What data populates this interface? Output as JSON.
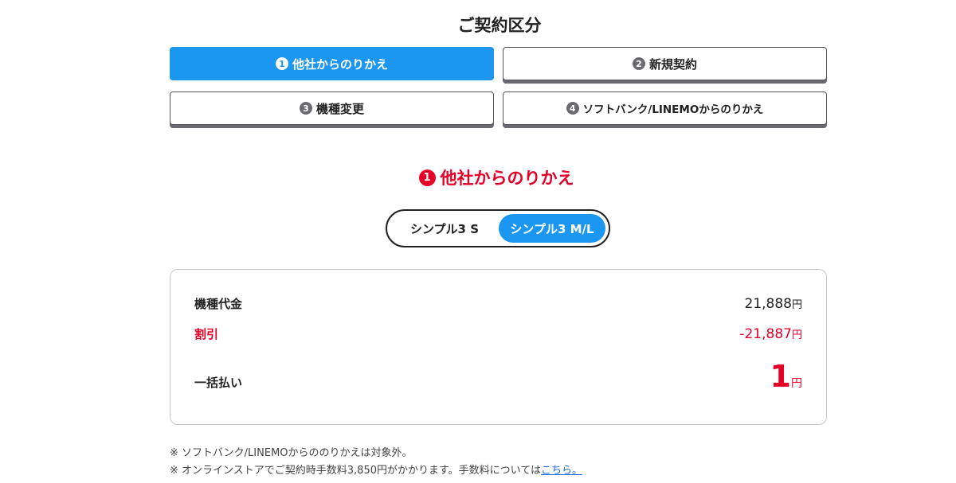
{
  "page_title": "ご契約区分",
  "tabs": [
    {
      "num": "1",
      "label": "他社からのりかえ",
      "active": true
    },
    {
      "num": "2",
      "label": "新規契約",
      "active": false
    },
    {
      "num": "3",
      "label": "機種変更",
      "active": false
    },
    {
      "num": "4",
      "label": "ソフトバンク/LINEMOからのりかえ",
      "active": false
    }
  ],
  "section": {
    "num": "1",
    "label": "他社からのりかえ"
  },
  "plan_toggle": {
    "options": [
      "シンプル3 S",
      "シンプル3 M/L"
    ],
    "selected": "シンプル3 M/L"
  },
  "price": {
    "device_label": "機種代金",
    "device_value": "21,888",
    "discount_label": "割引",
    "discount_value": "-21,887",
    "total_label": "一括払い",
    "total_value": "1",
    "currency": "円"
  },
  "notes": {
    "note1": "※ ソフトバンク/LINEMOからののりかえは対象外。",
    "note2": "※ オンラインストアでご契約時手数料3,850円がかかります。手数料については",
    "note2_link": "こちら。"
  },
  "colors": {
    "accent": "#1b97f1",
    "red": "#e60028"
  }
}
